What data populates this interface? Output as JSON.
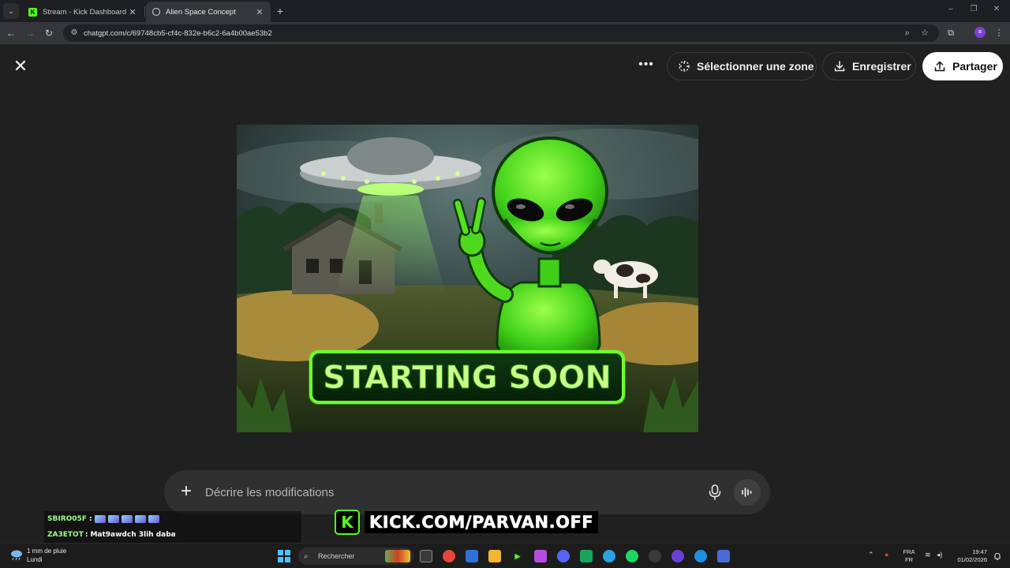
{
  "browser": {
    "tabs": [
      {
        "title": "Stream - Kick Dashboard",
        "favicon": "kick-icon",
        "active": false
      },
      {
        "title": "Alien Space Concept",
        "favicon": "chatgpt-icon",
        "active": true
      }
    ],
    "url": "chatgpt.com/c/69748cb5-cf4c-832e-b6c2-6a4b00ae53b2",
    "profile_initial": "a"
  },
  "viewer": {
    "actions": {
      "select_area": "Sélectionner une zone",
      "save": "Enregistrer",
      "share": "Partager"
    },
    "image": {
      "banner_text": "STARTING SOON",
      "accent_color": "#5cff1f"
    },
    "composer": {
      "placeholder": "Décrire les modifications"
    }
  },
  "overlay": {
    "chat": [
      {
        "user": "SBIRO05F",
        "message": ""
      },
      {
        "user": "ZA3ETOT",
        "message": "Mat9awdch 3lih daba"
      }
    ],
    "kick_url": "KICK.COM/PARVAN.OFF",
    "kick_color": "#53fc18"
  },
  "taskbar": {
    "weather": {
      "line1": "1 mm de pluie",
      "line2": "Lundi"
    },
    "search_label": "Rechercher",
    "language": {
      "line1": "FRA",
      "line2": "FR"
    },
    "clock": {
      "time": "19:47",
      "date": "01/02/2026"
    }
  }
}
